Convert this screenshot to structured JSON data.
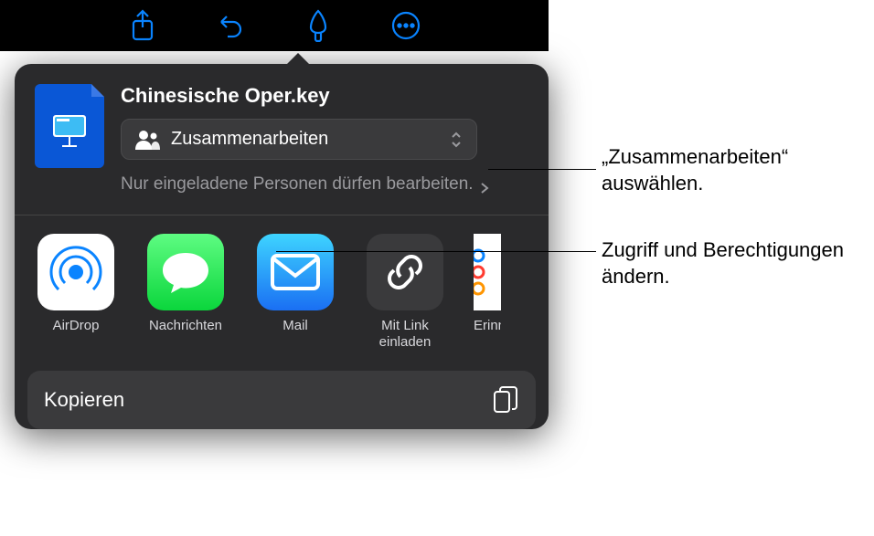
{
  "toolbar": {
    "share_icon": "share-icon",
    "undo_icon": "undo-icon",
    "format_icon": "paintbrush-icon",
    "more_icon": "more-icon"
  },
  "sheet": {
    "file_title": "Chinesische Oper.key",
    "collab_label": "Zusammenarbeiten",
    "permission_text": "Nur eingeladene Personen dürfen bearbeiten.",
    "apps": [
      {
        "label": "AirDrop"
      },
      {
        "label": "Nachrichten"
      },
      {
        "label": "Mail"
      },
      {
        "label": "Mit Link einladen"
      },
      {
        "label": "Erinnerungen"
      }
    ],
    "actions": {
      "copy_label": "Kopieren"
    }
  },
  "callouts": {
    "c1": "„Zusammenarbeiten“ auswählen.",
    "c2": "Zugriff und Berechtigungen ändern."
  }
}
